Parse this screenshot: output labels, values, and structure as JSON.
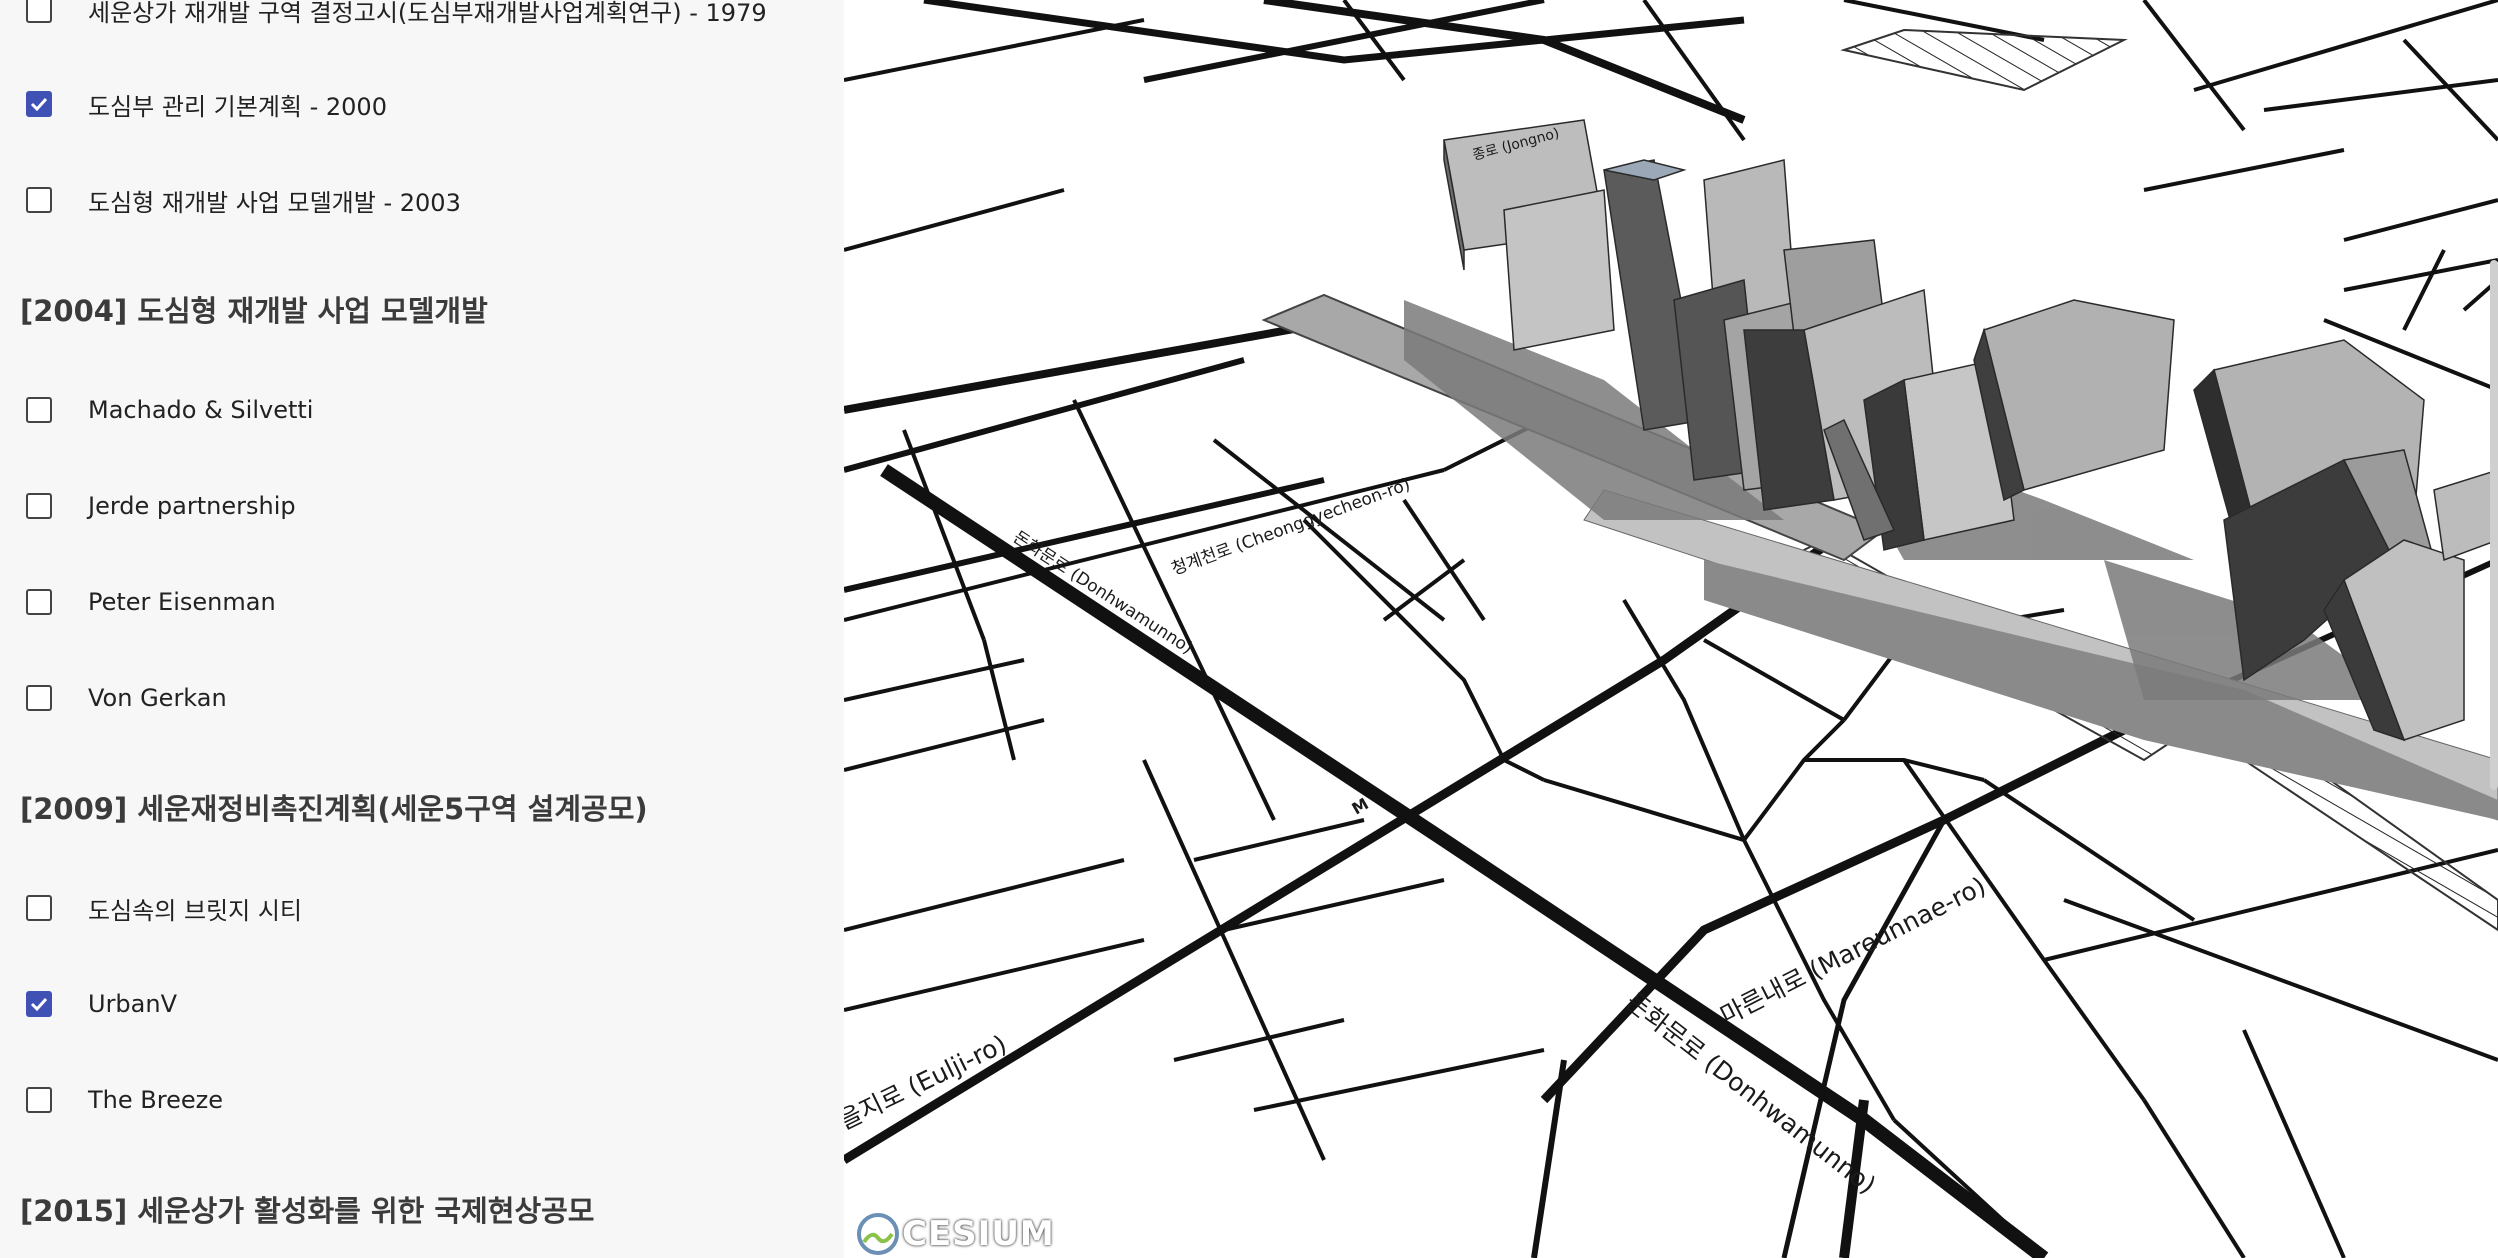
{
  "sidebar": {
    "items_top": [
      {
        "label": "세운상가 재개발 구역 결정고시(도심부재개발사업계획연구) - 1979",
        "checked": false
      },
      {
        "label": "도심부 관리 기본계획 - 2000",
        "checked": true
      },
      {
        "label": "도심형 재개발 사업 모델개발 - 2003",
        "checked": false
      }
    ],
    "heading_2004": "[2004] 도심형 재개발 사업 모델개발",
    "items_2004": [
      {
        "label": "Machado & Silvetti",
        "checked": false
      },
      {
        "label": "Jerde partnership",
        "checked": false
      },
      {
        "label": "Peter Eisenman",
        "checked": false
      },
      {
        "label": "Von Gerkan",
        "checked": false
      }
    ],
    "heading_2009": "[2009] 세운재정비촉진계획(세운5구역 설계공모)",
    "items_2009": [
      {
        "label": "도심속의 브릿지 시티",
        "checked": false
      },
      {
        "label": "UrbanV",
        "checked": true
      },
      {
        "label": "The Breeze",
        "checked": false
      }
    ],
    "heading_2015": "[2015] 세운상가 활성화를 위한 국제현상공모"
  },
  "map": {
    "roads": {
      "cheonggyecheon": "청계천로 (Cheonggyecheon-ro)",
      "donhwamunro_upper": "돈화문로 (Donhwamunno)",
      "donhwamunro_lower": "돈화문로 (Donhwamunno)",
      "mareunnae": "마른내로 (Mareunnae-ro)",
      "eulji": "을지로 (Eulji-ro)",
      "jongno": "종로 (Jongno)",
      "metro_marker": "M"
    },
    "attribution": "CESIUM",
    "colors": {
      "road": "#111111",
      "building_light": "#b4b4b4",
      "building_dark": "#3a3a3a",
      "building_mid": "#8c8c8c",
      "shadow": "#7a7a7a"
    }
  }
}
